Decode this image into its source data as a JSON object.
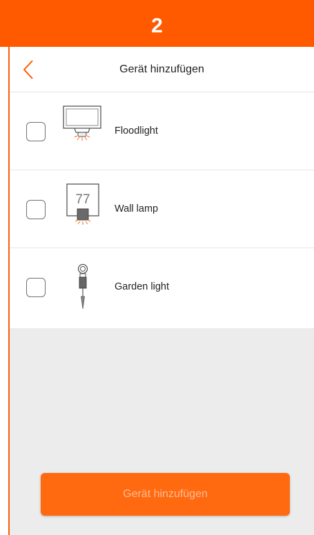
{
  "step": {
    "number": "2"
  },
  "header": {
    "title": "Gerät hinzufügen",
    "back_icon": "chevron-left-icon"
  },
  "devices": [
    {
      "label": "Floodlight",
      "icon": "floodlight-icon",
      "checked": false
    },
    {
      "label": "Wall lamp",
      "icon": "wall-lamp-icon",
      "checked": false,
      "icon_text": "77"
    },
    {
      "label": "Garden light",
      "icon": "garden-light-icon",
      "checked": false
    }
  ],
  "footer": {
    "button_label": "Gerät hinzufügen",
    "button_enabled": false
  },
  "colors": {
    "accent": "#FF5A00",
    "button": "#FF6A10",
    "footer_bg": "#ECECEC"
  }
}
